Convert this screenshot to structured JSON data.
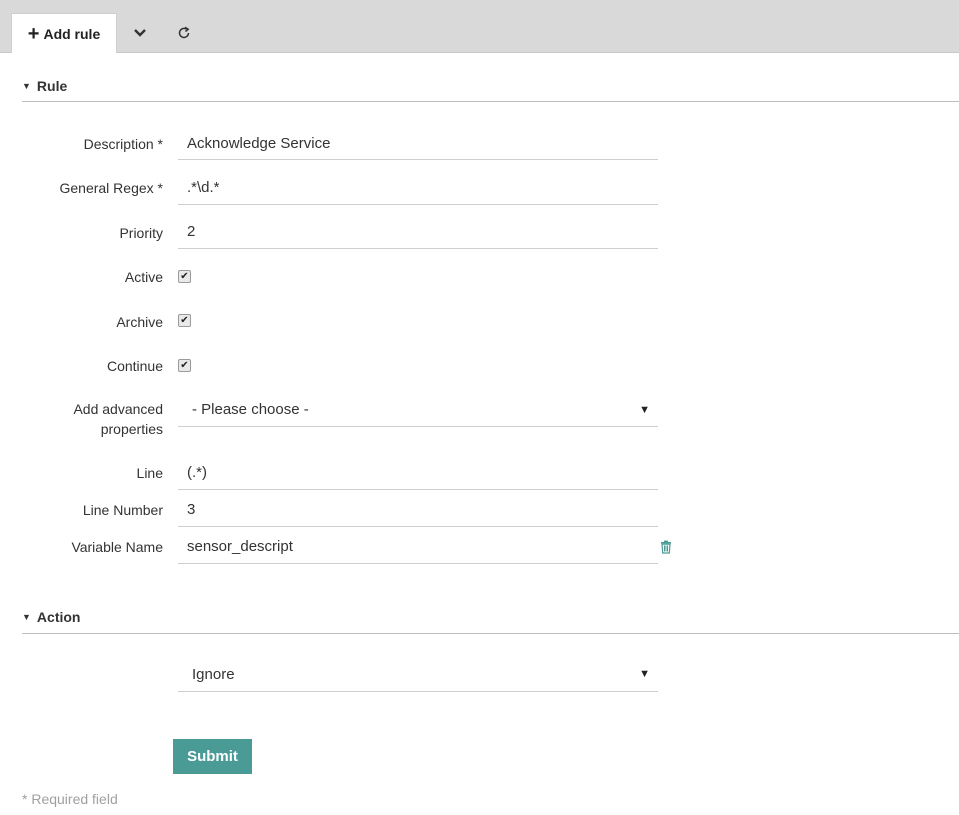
{
  "toolbar": {
    "add_rule_label": "Add rule",
    "dropdown_icon": "chevron-down-icon",
    "refresh_icon": "refresh-icon"
  },
  "sections": {
    "rule": "Rule",
    "action": "Action"
  },
  "form": {
    "description_label": "Description *",
    "description_value": "Acknowledge Service",
    "regex_label": "General Regex *",
    "regex_value": ".*\\d.*",
    "priority_label": "Priority",
    "priority_value": "2",
    "active_label": "Active",
    "active_checked": true,
    "archive_label": "Archive",
    "archive_checked": true,
    "continue_label": "Continue",
    "continue_checked": true,
    "advanced_label_line1": "Add advanced",
    "advanced_label_line2": "properties",
    "advanced_value": "- Please choose -",
    "line_label": "Line",
    "line_value": "(.*)",
    "line_number_label": "Line Number",
    "line_number_value": "3",
    "variable_name_label": "Variable Name",
    "variable_name_value": "sensor_descript",
    "action_value": "Ignore"
  },
  "submit_label": "Submit",
  "required_note": "* Required field",
  "colors": {
    "accent": "#4a9a96",
    "toolbar_bg": "#d9d9d9"
  }
}
